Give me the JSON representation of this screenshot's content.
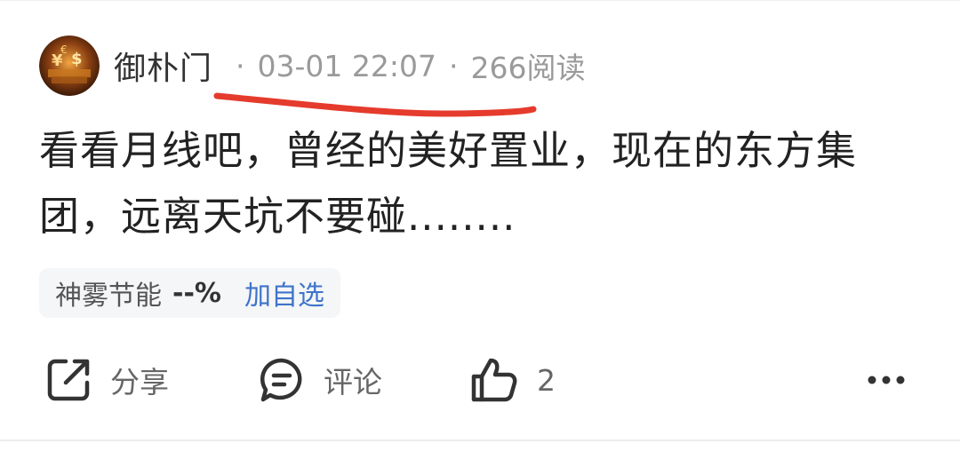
{
  "post": {
    "author": "御朴门",
    "date": "03-01 22:07",
    "separator": "·",
    "reads": "266阅读",
    "text": "看看月线吧，曾经的美好置业，现在的东方集团，远离天坑不要碰........"
  },
  "stock_tag": {
    "name": "神雾节能",
    "change": "--%",
    "action": "加自选"
  },
  "actions": {
    "share": "分享",
    "comment": "评论",
    "like_count": "2"
  },
  "colors": {
    "text": "#222222",
    "meta": "#9a9a9a",
    "link": "#3f74c9",
    "annotation": "#e53b2c"
  },
  "icons": [
    "share-icon",
    "comment-icon",
    "like-icon",
    "more-icon"
  ]
}
